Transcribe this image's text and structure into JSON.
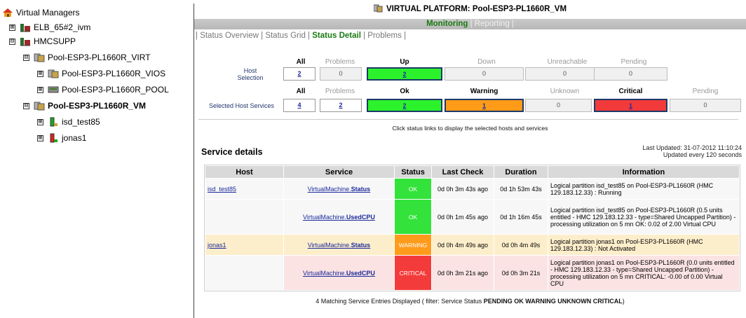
{
  "tree": {
    "root": "Virtual Managers",
    "items": [
      {
        "label": "ELB_65#2_ivm",
        "icon": "manager-icon"
      },
      {
        "label": "HMCSUPP",
        "icon": "manager-icon"
      },
      {
        "label": "Pool-ESP3-PL1660R_VIRT",
        "icon": "pool-icon"
      },
      {
        "label": "Pool-ESP3-PL1660R_VIOS",
        "icon": "pool-icon"
      },
      {
        "label": "Pool-ESP3-PL1660R_POOL",
        "icon": "pool-server-icon"
      },
      {
        "label": "Pool-ESP3-PL1660R_VM",
        "icon": "pool-icon"
      },
      {
        "label": "isd_test85",
        "icon": "vm-green-icon"
      },
      {
        "label": "jonas1",
        "icon": "vm-red-icon"
      }
    ],
    "expander": "⊞",
    "collapser": "⊟"
  },
  "header": {
    "title": "VIRTUAL PLATFORM: Pool-ESP3-PL1660R_VM",
    "modes": [
      "Monitoring",
      "Reporting"
    ],
    "subnav": [
      "Status Overview",
      "Status Grid",
      "Status Detail",
      "Problems"
    ]
  },
  "summary": {
    "host": {
      "row_label": "Host\nSelection",
      "headers": [
        "All",
        "Problems",
        "Up",
        "Down",
        "Unreachable",
        "Pending"
      ],
      "values": [
        "2",
        "0",
        "2",
        "0",
        "0",
        "0"
      ]
    },
    "services": {
      "row_label": "Selected Host Services",
      "headers": [
        "All",
        "Problems",
        "Ok",
        "Warning",
        "Unknown",
        "Critical",
        "Pending"
      ],
      "values": [
        "4",
        "2",
        "2",
        "1",
        "0",
        "1",
        "0"
      ]
    },
    "note": "Click status links to display the selected hosts and services",
    "colors": {
      "up": "#2cf22c",
      "warning": "#ff9b17",
      "critical": "#f23a3a"
    }
  },
  "details": {
    "title": "Service details",
    "last_updated": "Last Updated: 31-07-2012 11:10:24",
    "update_every": "Updated every 120 seconds",
    "columns": [
      "Host",
      "Service",
      "Status",
      "Last Check",
      "Duration",
      "Information"
    ],
    "rows": [
      {
        "host": "isd_test85",
        "service_prefix": "VirtualMachine.",
        "service_name": "Status",
        "status": "OK",
        "last_check": "0d 0h 3m 43s ago",
        "duration": "0d 1h 53m 43s",
        "info": "Logical partition isd_test85 on Pool-ESP3-PL1660R (HMC 129.183.12.33) : Running"
      },
      {
        "host": "",
        "service_prefix": "VirtualMachine.",
        "service_name": "UsedCPU",
        "status": "OK",
        "last_check": "0d 0h 1m 45s ago",
        "duration": "0d 1h 16m 45s",
        "info": "Logical partition isd_test85 on Pool-ESP3-PL1660R (0.5 units entitled - HMC 129.183.12.33 - type=Shared Uncapped Partition) - processing utilization on 5 mn OK: 0.02 of 2.00 Virtual CPU"
      },
      {
        "host": "jonas1",
        "service_prefix": "VirtualMachine.",
        "service_name": "Status",
        "status": "WARNING",
        "last_check": "0d 0h 4m 49s ago",
        "duration": "0d 0h 4m 49s",
        "info": "Logical partition jonas1 on Pool-ESP3-PL1660R (HMC 129.183.12.33) : Not Activated"
      },
      {
        "host": "",
        "service_prefix": "VirtualMachine.",
        "service_name": "UsedCPU",
        "status": "CRITICAL",
        "last_check": "0d 0h 3m 21s ago",
        "duration": "0d 0h 3m 21s",
        "info": "Logical partition jonas1 on Pool-ESP3-PL1660R (0.0 units entitled - HMC 129.183.12.33 - type=Shared Uncapped Partition) - processing utilization on 5 mn CRITICAL: -0.00 of 0.00 Virtual CPU"
      }
    ]
  },
  "footer": {
    "prefix": "4 Matching Service Entries Displayed ( filter: Service Status ",
    "filter": "PENDING OK WARNING UNKNOWN CRITICAL",
    "suffix": ")"
  }
}
